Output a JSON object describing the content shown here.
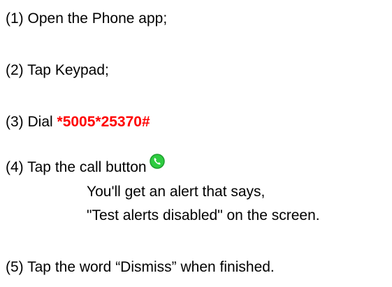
{
  "steps": {
    "step1": "(1) Open the Phone app;",
    "step2": "(2) Tap Keypad;",
    "step3_prefix": "(3) Dial ",
    "step3_code": "*5005*25370#",
    "step4": "(4) Tap the call button",
    "step4_sub1": "You'll get an alert that says,",
    "step4_sub2": "\"Test alerts disabled\" on the screen.",
    "step5": "(5) Tap the word “Dismiss” when finished."
  },
  "icons": {
    "call_button": "phone-call-icon"
  },
  "colors": {
    "code_text": "#ff0000",
    "call_icon_fill": "#2ecc40",
    "call_icon_border": "#1e9e2e"
  }
}
